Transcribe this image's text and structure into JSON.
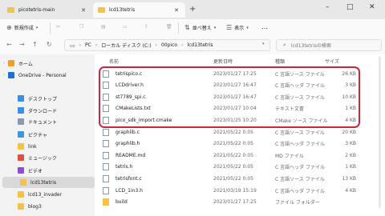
{
  "tabs": [
    {
      "label": "picotetris-main"
    },
    {
      "label": "lcd13tetris"
    }
  ],
  "new_tab": "+",
  "window": {
    "min": "–",
    "max": "□",
    "close": "✕"
  },
  "toolbar": {
    "new": "新規作成",
    "sort": "並べ替え",
    "view": "表示",
    "more": "…"
  },
  "address": {
    "crumbs": [
      "PC",
      "ローカル ディスク (C:)",
      "00pico",
      "lcd13tetris"
    ]
  },
  "search": {
    "placeholder": "lcd13tetrisの検索"
  },
  "sidebar": {
    "items": [
      {
        "label": "ホーム",
        "color": "#f0a030"
      },
      {
        "label": "OneDrive - Personal",
        "color": "#1e6fd9"
      },
      {
        "label": "デスクトップ",
        "color": "#3a8ee6"
      },
      {
        "label": "ダウンロード",
        "color": "#3a8ee6"
      },
      {
        "label": "ドキュメント",
        "color": "#8a9bb0"
      },
      {
        "label": "ピクチャ",
        "color": "#3a9ad9"
      },
      {
        "label": "link",
        "color": "#f3c24a"
      },
      {
        "label": "ミュージック",
        "color": "#e0503a"
      },
      {
        "label": "ビデオ",
        "color": "#8a4fd0"
      },
      {
        "label": "lcd13tetris",
        "color": "#f3c24a"
      },
      {
        "label": "lcd13_invader",
        "color": "#f3c24a"
      },
      {
        "label": "blog3",
        "color": "#f3c24a"
      }
    ]
  },
  "columns": {
    "name": "名前",
    "date": "更新日時",
    "type": "種類",
    "size": "サイズ"
  },
  "files": [
    {
      "name": "tetrispico.c",
      "date": "2023/01/27 17:25",
      "type": "C 言語ソース ファイル",
      "size": "26 KB"
    },
    {
      "name": "LCDdriver.h",
      "date": "2023/01/27 16:47",
      "type": "C 言語ヘッダ ファイル",
      "size": "3 KB"
    },
    {
      "name": "st7789_spi.c",
      "date": "2023/01/27 16:47",
      "type": "C 言語ソース ファイル",
      "size": "10 KB"
    },
    {
      "name": "CMakeLists.txt",
      "date": "2023/01/27 10:04",
      "type": "テキスト文書",
      "size": "1 KB"
    },
    {
      "name": "pico_sdk_import.cmake",
      "date": "2023/01/25 10:20",
      "type": "CMake ソース ファイル",
      "size": "4 KB"
    },
    {
      "name": "graphlib.c",
      "date": "2021/05/22 0:05",
      "type": "C 言語ソース ファイル",
      "size": "20 KB"
    },
    {
      "name": "graphlib.h",
      "date": "2021/05/22 0:05",
      "type": "C 言語ヘッダ ファイル",
      "size": "3 KB"
    },
    {
      "name": "README.md",
      "date": "2021/05/22 0:05",
      "type": "MD ファイル",
      "size": "2 KB"
    },
    {
      "name": "tetris.h",
      "date": "2021/05/22 0:05",
      "type": "C 言語ヘッダ ファイル",
      "size": "1 KB"
    },
    {
      "name": "tetrisfont.c",
      "date": "2021/05/22 0:05",
      "type": "C 言語ソース ファイル",
      "size": "13 KB"
    },
    {
      "name": "LCD_1in3.h",
      "date": "2021/03/19 15:19",
      "type": "C 言語ヘッダ ファイル",
      "size": "4 KB"
    },
    {
      "name": "build",
      "date": "2023/01/27 17:25",
      "type": "ファイル フォルダー",
      "size": ""
    }
  ]
}
